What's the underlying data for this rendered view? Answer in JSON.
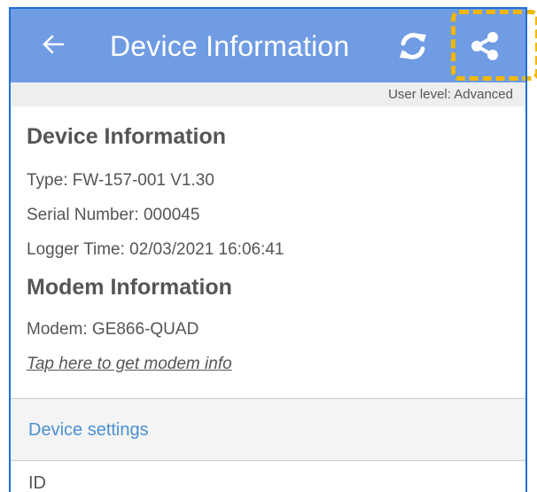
{
  "appbar": {
    "title": "Device Information",
    "back_icon": "arrow-left-icon",
    "refresh_icon": "refresh-icon",
    "share_icon": "share-icon",
    "background": "#6f9ce3"
  },
  "user_level": "User level: Advanced",
  "device_info": {
    "heading": "Device Information",
    "type": "Type: FW-157-001 V1.30",
    "serial": "Serial Number:  000045",
    "logger_time": "Logger Time: 02/03/2021 16:06:41"
  },
  "modem_info": {
    "heading": "Modem Information",
    "modem": "Modem: GE866-QUAD",
    "link": "Tap here to get modem info"
  },
  "device_settings": {
    "label": "Device settings",
    "accent": "#4a90d0"
  },
  "settings_list": {
    "first_item": "ID"
  },
  "highlight_color": "#f2b705",
  "frame_color": "#1e6fd6"
}
